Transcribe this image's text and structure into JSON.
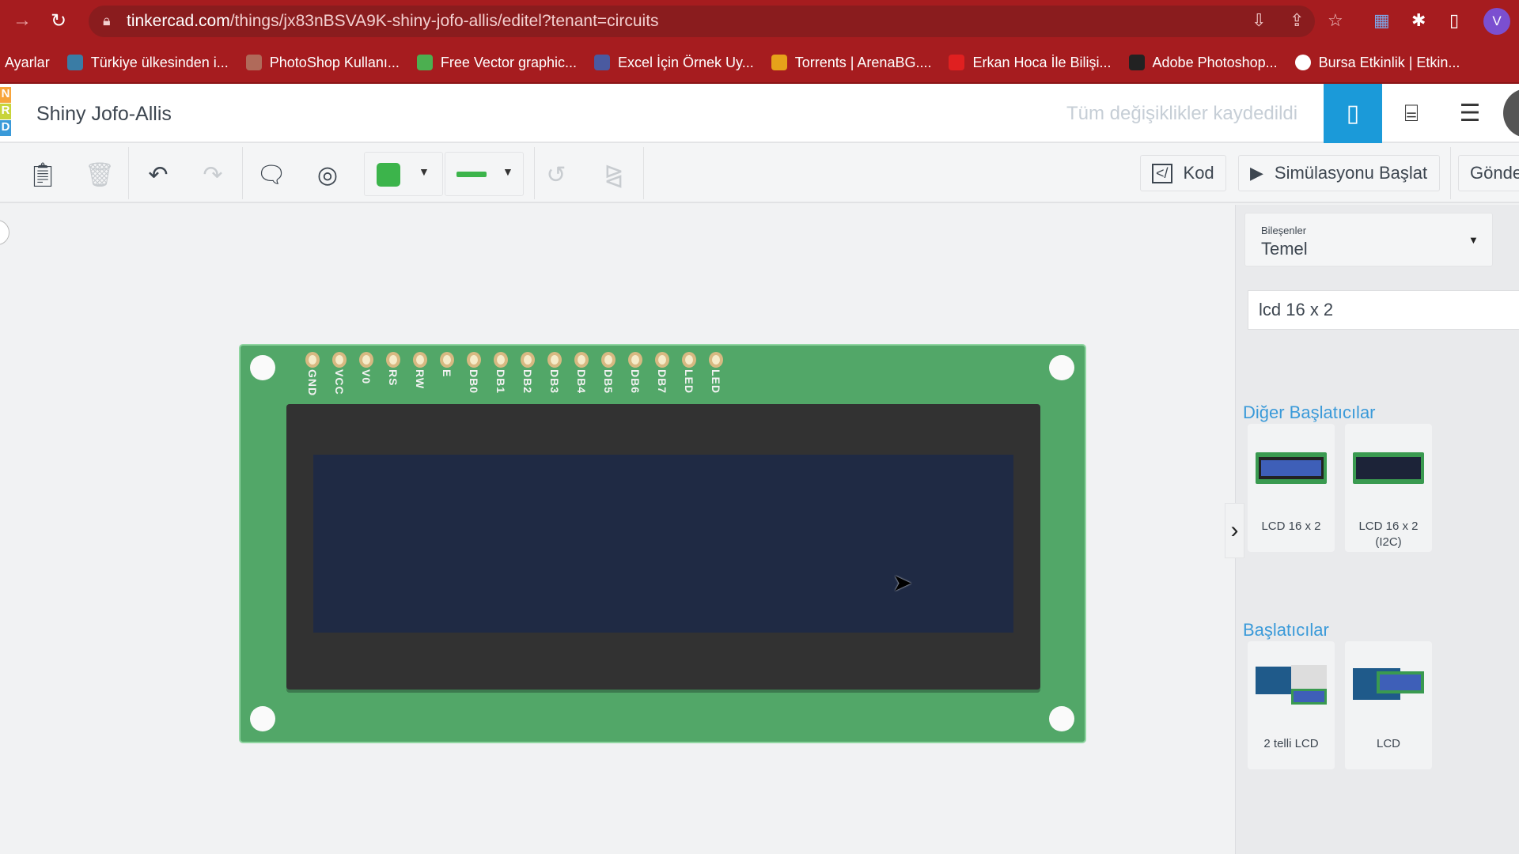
{
  "browser": {
    "url_domain": "tinkercad.com",
    "url_path": "/things/jx83nBSVA9K-shiny-jofo-allis/editel?tenant=circuits",
    "avatar_letter": "V",
    "bookmarks": [
      {
        "label": "Ayarlar",
        "color": ""
      },
      {
        "label": "Türkiye ülkesinden i...",
        "color": "#3a7ca5"
      },
      {
        "label": "PhotoShop Kullanı...",
        "color": "#b06a5a"
      },
      {
        "label": "Free Vector graphic...",
        "color": "#4caf50"
      },
      {
        "label": "Excel İçin Örnek Uy...",
        "color": "#4a5aa0"
      },
      {
        "label": "Torrents | ArenaBG....",
        "color": "#e6a21a"
      },
      {
        "label": "Erkan Hoca İle Bilişi...",
        "color": "#e02020"
      },
      {
        "label": "Adobe Photoshop...",
        "color": "#222222"
      },
      {
        "label": "Bursa Etkinlik | Etkin...",
        "color": "#ffffff"
      }
    ]
  },
  "app": {
    "logo": [
      "N",
      "R",
      "D"
    ],
    "logo_colors": [
      "#f7a43b",
      "#c8d43a",
      "#3a9ad9"
    ],
    "title": "Shiny Jofo-Allis",
    "save_status": "Tüm değişiklikler kaydedildi",
    "accent": "#1b9ad9"
  },
  "toolbar": {
    "code_label": "Kod",
    "simulate_label": "Simülasyonu Başlat",
    "send_label": "Gönde",
    "color_value": "#3cb44b"
  },
  "lcd": {
    "pins": [
      "GND",
      "VCC",
      "V0",
      "RS",
      "RW",
      "E",
      "DB0",
      "DB1",
      "DB2",
      "DB3",
      "DB4",
      "DB5",
      "DB6",
      "DB7",
      "LED",
      "LED"
    ]
  },
  "panel": {
    "dropdown_label": "Bileşenler",
    "dropdown_value": "Temel",
    "search_value": "lcd 16 x 2",
    "sections": [
      {
        "title": "Diğer Başlatıcılar",
        "items": [
          "LCD 16 x 2",
          "LCD 16 x 2 (I2C)"
        ]
      },
      {
        "title": "Başlatıcılar",
        "items": [
          "2 telli LCD",
          "LCD"
        ]
      }
    ]
  }
}
